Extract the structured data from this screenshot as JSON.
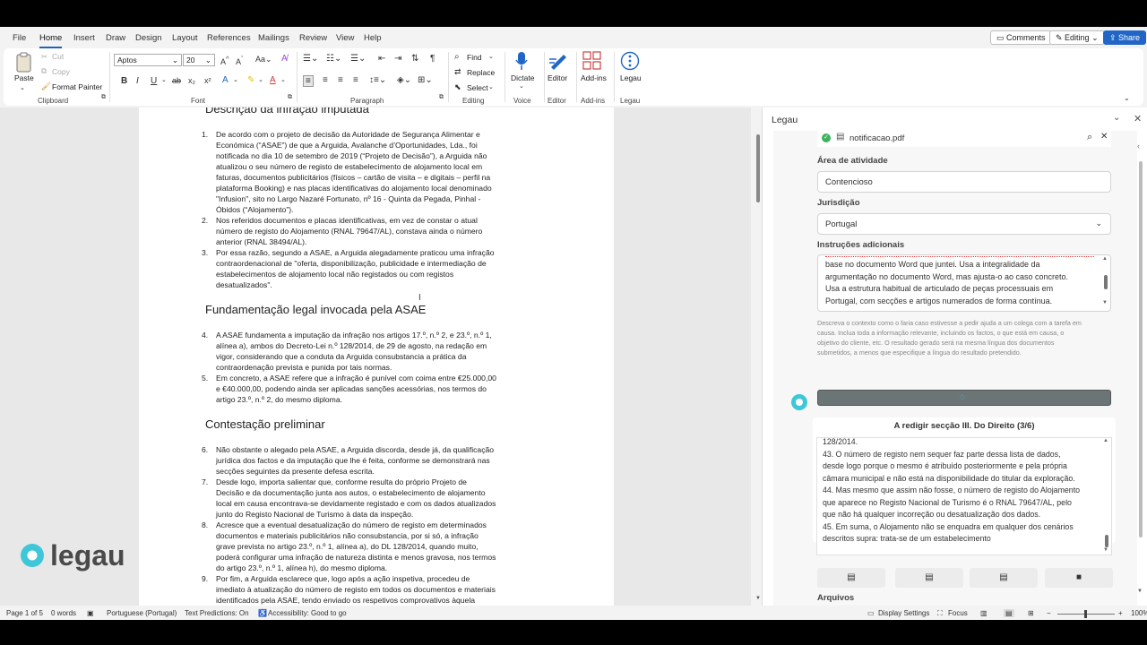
{
  "menu": {
    "tabs": [
      "File",
      "Home",
      "Insert",
      "Draw",
      "Design",
      "Layout",
      "References",
      "Mailings",
      "Review",
      "View",
      "Help"
    ],
    "comments": "Comments",
    "editing": "Editing",
    "share": "Share"
  },
  "ribbon": {
    "paste": "Paste",
    "cut": "Cut",
    "copy": "Copy",
    "format_painter": "Format Painter",
    "clipboard": "Clipboard",
    "font_name": "Aptos",
    "font_size": "20",
    "font": "Font",
    "paragraph": "Paragraph",
    "find": "Find",
    "replace": "Replace",
    "select": "Select",
    "editing_group": "Editing",
    "dictate": "Dictate",
    "voice": "Voice",
    "editor": "Editor",
    "editor_group": "Editor",
    "addins": "Add-ins",
    "addins_group": "Add-ins",
    "legau": "Legau",
    "legau_group": "Legau"
  },
  "document": {
    "heading1": "Descrição da infração imputada",
    "items1": [
      {
        "n": "1.",
        "lines": [
          "De acordo com o projeto de decisão da Autoridade de Segurança Alimentar e",
          "Económica (“ASAE”) de que a Arguida, Avalanche d’Oportunidades, Lda., foi",
          "notificada no dia 10 de setembro de 2019 (“Projeto de Decisão”), a Arguida não",
          "atualizou o seu número de registo de estabelecimento de alojamento local em",
          "faturas, documentos publicitários (físicos – cartão de visita – e digitais – perfil na",
          "plataforma Booking) e nas placas identificativas do alojamento local denominado",
          "\"Infusion\", sito no Largo Nazaré Fortunato, nº 16 - Quinta da Pegada, Pinhal -",
          "Óbidos (“Alojamento”)."
        ]
      },
      {
        "n": "2.",
        "lines": [
          "Nos referidos documentos e placas identificativas, em vez de constar o atual",
          "número de registo do Alojamento (RNAL 79647/AL), constava ainda o número",
          "anterior (RNAL 38494/AL)."
        ]
      },
      {
        "n": "3.",
        "lines": [
          "Por essa razão, segundo a ASAE, a Arguida alegadamente praticou uma infração",
          "contraordenacional de \"oferta, disponibilização, publicidade e intermediação de",
          "estabelecimentos de alojamento local não registados ou com registos",
          "desatualizados\"."
        ]
      }
    ],
    "heading2": "Fundamentação legal invocada pela ASAE",
    "items2": [
      {
        "n": "4.",
        "lines": [
          "A ASAE fundamenta a imputação da infração nos artigos 17.º, n.º 2, e 23.º, n.º 1,",
          "alínea a), ambos do Decreto-Lei n.º 128/2014, de 29 de agosto, na redação em",
          "vigor, considerando que a conduta da Arguida consubstancia a prática da",
          "contraordenação prevista e punida por tais normas."
        ]
      },
      {
        "n": "5.",
        "lines": [
          "Em concreto, a ASAE refere que a infração é punível com coima entre €25.000,00",
          "e €40.000,00, podendo ainda ser aplicadas sanções acessórias, nos termos do",
          "artigo 23.º, n.º 2, do mesmo diploma."
        ]
      }
    ],
    "heading3": "Contestação preliminar",
    "items3": [
      {
        "n": "6.",
        "lines": [
          "Não obstante o alegado pela ASAE, a Arguida discorda, desde já, da qualificação",
          "jurídica dos factos e da imputação que lhe é feita, conforme se demonstrará nas",
          "secções seguintes da presente defesa escrita."
        ]
      },
      {
        "n": "7.",
        "lines": [
          "Desde logo, importa salientar que, conforme resulta do próprio Projeto de",
          "Decisão e da documentação junta aos autos, o estabelecimento de alojamento",
          "local em causa encontrava-se devidamente registado e com os dados atualizados",
          "junto do Registo Nacional de Turismo à data da inspeção."
        ]
      },
      {
        "n": "8.",
        "lines": [
          "Acresce que a eventual desatualização do número de registo em determinados",
          "documentos e materiais publicitários não consubstancia, por si só, a infração",
          "grave prevista no artigo 23.º, n.º 1, alínea a), do DL 128/2014, quando muito,",
          "poderá configurar uma infração de natureza distinta e menos gravosa, nos termos",
          "do artigo 23.º, n.º 1, alínea h), do mesmo diploma."
        ]
      },
      {
        "n": "9.",
        "lines": [
          "Por fim, a Arguida esclarece que, logo após a ação inspetiva, procedeu de",
          "imediato à atualização do número de registo em todos os documentos e materiais",
          "identificados pela ASAE, tendo enviado os respetivos comprovativos àquela"
        ]
      }
    ],
    "logo": "legau"
  },
  "panel": {
    "title": "Legau",
    "file_name": "notificacao.pdf",
    "area_label": "Área de atividade",
    "area_value": "Contencioso",
    "jurisdiction_label": "Jurisdição",
    "jurisdiction_value": "Portugal",
    "instructions_label": "Instruções adicionais",
    "instructions_lines": [
      "base no documento Word que juntei. Usa a integralidade da",
      "argumentação no documento Word, mas ajusta-o ao caso concreto.",
      "Usa a estrutura habitual de articulado de peças processuais em",
      "Portugal, com secções e artigos numerados de forma contínua."
    ],
    "hint_lines": [
      "Descreva o contexto como o faria caso estivesse a pedir ajuda a um colega com a tarefa em",
      "causa. Inclua toda a informação relevante, incluindo os factos, o que está em causa, o",
      "objetivo do cliente, etc. O resultado gerado será na mesma língua dos documentos",
      "submetidos, a menos que especifique a língua do resultado pretendido."
    ],
    "progress_title": "A redigir secção III. Do Direito (3/6)",
    "output_lines": [
      "128/2014.",
      "43. O número de registo nem sequer faz parte dessa lista de dados,",
      "desde logo porque o mesmo é atribuído posteriormente e pela própria",
      "câmara municipal e não está na disponibilidade do titular da exploração.",
      "44. Mas mesmo que assim não fosse, o número de registo do Alojamento",
      "que aparece no Registo Nacional de Turismo é o RNAL 79647/AL, pelo",
      "que não há qualquer incorreção ou desatualização dos dados.",
      "45. Em suma, o Alojamento não se enquadra em qualquer dos cenários",
      "descritos supra: trata-se de um estabelecimento"
    ],
    "files_label": "Arquivos"
  },
  "status": {
    "page": "Page 1 of 5",
    "words": "0 words",
    "language": "Portuguese (Portugal)",
    "predictions": "Text Predictions: On",
    "accessibility": "Accessibility: Good to go",
    "display": "Display Settings",
    "focus": "Focus",
    "zoom": "100%"
  }
}
